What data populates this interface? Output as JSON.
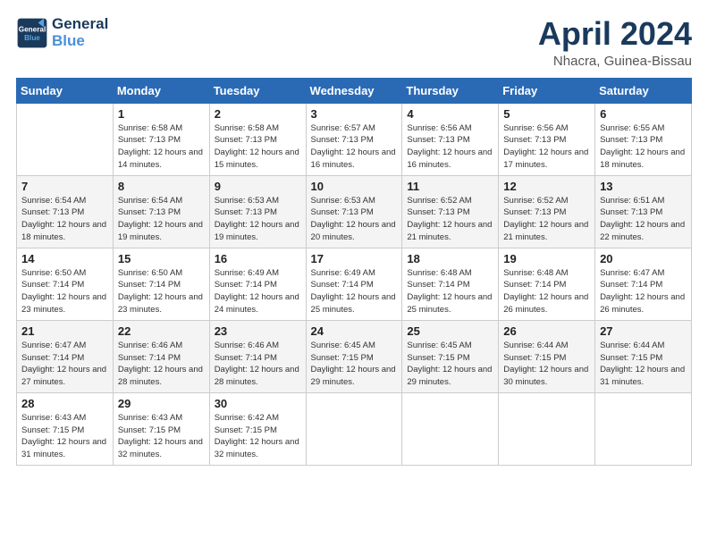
{
  "logo": {
    "line1": "General",
    "line2": "Blue"
  },
  "title": {
    "month_year": "April 2024",
    "location": "Nhacra, Guinea-Bissau"
  },
  "weekdays": [
    "Sunday",
    "Monday",
    "Tuesday",
    "Wednesday",
    "Thursday",
    "Friday",
    "Saturday"
  ],
  "weeks": [
    [
      {
        "day": "",
        "sunrise": "",
        "sunset": "",
        "daylight": ""
      },
      {
        "day": "1",
        "sunrise": "Sunrise: 6:58 AM",
        "sunset": "Sunset: 7:13 PM",
        "daylight": "Daylight: 12 hours and 14 minutes."
      },
      {
        "day": "2",
        "sunrise": "Sunrise: 6:58 AM",
        "sunset": "Sunset: 7:13 PM",
        "daylight": "Daylight: 12 hours and 15 minutes."
      },
      {
        "day": "3",
        "sunrise": "Sunrise: 6:57 AM",
        "sunset": "Sunset: 7:13 PM",
        "daylight": "Daylight: 12 hours and 16 minutes."
      },
      {
        "day": "4",
        "sunrise": "Sunrise: 6:56 AM",
        "sunset": "Sunset: 7:13 PM",
        "daylight": "Daylight: 12 hours and 16 minutes."
      },
      {
        "day": "5",
        "sunrise": "Sunrise: 6:56 AM",
        "sunset": "Sunset: 7:13 PM",
        "daylight": "Daylight: 12 hours and 17 minutes."
      },
      {
        "day": "6",
        "sunrise": "Sunrise: 6:55 AM",
        "sunset": "Sunset: 7:13 PM",
        "daylight": "Daylight: 12 hours and 18 minutes."
      }
    ],
    [
      {
        "day": "7",
        "sunrise": "Sunrise: 6:54 AM",
        "sunset": "Sunset: 7:13 PM",
        "daylight": "Daylight: 12 hours and 18 minutes."
      },
      {
        "day": "8",
        "sunrise": "Sunrise: 6:54 AM",
        "sunset": "Sunset: 7:13 PM",
        "daylight": "Daylight: 12 hours and 19 minutes."
      },
      {
        "day": "9",
        "sunrise": "Sunrise: 6:53 AM",
        "sunset": "Sunset: 7:13 PM",
        "daylight": "Daylight: 12 hours and 19 minutes."
      },
      {
        "day": "10",
        "sunrise": "Sunrise: 6:53 AM",
        "sunset": "Sunset: 7:13 PM",
        "daylight": "Daylight: 12 hours and 20 minutes."
      },
      {
        "day": "11",
        "sunrise": "Sunrise: 6:52 AM",
        "sunset": "Sunset: 7:13 PM",
        "daylight": "Daylight: 12 hours and 21 minutes."
      },
      {
        "day": "12",
        "sunrise": "Sunrise: 6:52 AM",
        "sunset": "Sunset: 7:13 PM",
        "daylight": "Daylight: 12 hours and 21 minutes."
      },
      {
        "day": "13",
        "sunrise": "Sunrise: 6:51 AM",
        "sunset": "Sunset: 7:13 PM",
        "daylight": "Daylight: 12 hours and 22 minutes."
      }
    ],
    [
      {
        "day": "14",
        "sunrise": "Sunrise: 6:50 AM",
        "sunset": "Sunset: 7:14 PM",
        "daylight": "Daylight: 12 hours and 23 minutes."
      },
      {
        "day": "15",
        "sunrise": "Sunrise: 6:50 AM",
        "sunset": "Sunset: 7:14 PM",
        "daylight": "Daylight: 12 hours and 23 minutes."
      },
      {
        "day": "16",
        "sunrise": "Sunrise: 6:49 AM",
        "sunset": "Sunset: 7:14 PM",
        "daylight": "Daylight: 12 hours and 24 minutes."
      },
      {
        "day": "17",
        "sunrise": "Sunrise: 6:49 AM",
        "sunset": "Sunset: 7:14 PM",
        "daylight": "Daylight: 12 hours and 25 minutes."
      },
      {
        "day": "18",
        "sunrise": "Sunrise: 6:48 AM",
        "sunset": "Sunset: 7:14 PM",
        "daylight": "Daylight: 12 hours and 25 minutes."
      },
      {
        "day": "19",
        "sunrise": "Sunrise: 6:48 AM",
        "sunset": "Sunset: 7:14 PM",
        "daylight": "Daylight: 12 hours and 26 minutes."
      },
      {
        "day": "20",
        "sunrise": "Sunrise: 6:47 AM",
        "sunset": "Sunset: 7:14 PM",
        "daylight": "Daylight: 12 hours and 26 minutes."
      }
    ],
    [
      {
        "day": "21",
        "sunrise": "Sunrise: 6:47 AM",
        "sunset": "Sunset: 7:14 PM",
        "daylight": "Daylight: 12 hours and 27 minutes."
      },
      {
        "day": "22",
        "sunrise": "Sunrise: 6:46 AM",
        "sunset": "Sunset: 7:14 PM",
        "daylight": "Daylight: 12 hours and 28 minutes."
      },
      {
        "day": "23",
        "sunrise": "Sunrise: 6:46 AM",
        "sunset": "Sunset: 7:14 PM",
        "daylight": "Daylight: 12 hours and 28 minutes."
      },
      {
        "day": "24",
        "sunrise": "Sunrise: 6:45 AM",
        "sunset": "Sunset: 7:15 PM",
        "daylight": "Daylight: 12 hours and 29 minutes."
      },
      {
        "day": "25",
        "sunrise": "Sunrise: 6:45 AM",
        "sunset": "Sunset: 7:15 PM",
        "daylight": "Daylight: 12 hours and 29 minutes."
      },
      {
        "day": "26",
        "sunrise": "Sunrise: 6:44 AM",
        "sunset": "Sunset: 7:15 PM",
        "daylight": "Daylight: 12 hours and 30 minutes."
      },
      {
        "day": "27",
        "sunrise": "Sunrise: 6:44 AM",
        "sunset": "Sunset: 7:15 PM",
        "daylight": "Daylight: 12 hours and 31 minutes."
      }
    ],
    [
      {
        "day": "28",
        "sunrise": "Sunrise: 6:43 AM",
        "sunset": "Sunset: 7:15 PM",
        "daylight": "Daylight: 12 hours and 31 minutes."
      },
      {
        "day": "29",
        "sunrise": "Sunrise: 6:43 AM",
        "sunset": "Sunset: 7:15 PM",
        "daylight": "Daylight: 12 hours and 32 minutes."
      },
      {
        "day": "30",
        "sunrise": "Sunrise: 6:42 AM",
        "sunset": "Sunset: 7:15 PM",
        "daylight": "Daylight: 12 hours and 32 minutes."
      },
      {
        "day": "",
        "sunrise": "",
        "sunset": "",
        "daylight": ""
      },
      {
        "day": "",
        "sunrise": "",
        "sunset": "",
        "daylight": ""
      },
      {
        "day": "",
        "sunrise": "",
        "sunset": "",
        "daylight": ""
      },
      {
        "day": "",
        "sunrise": "",
        "sunset": "",
        "daylight": ""
      }
    ]
  ]
}
